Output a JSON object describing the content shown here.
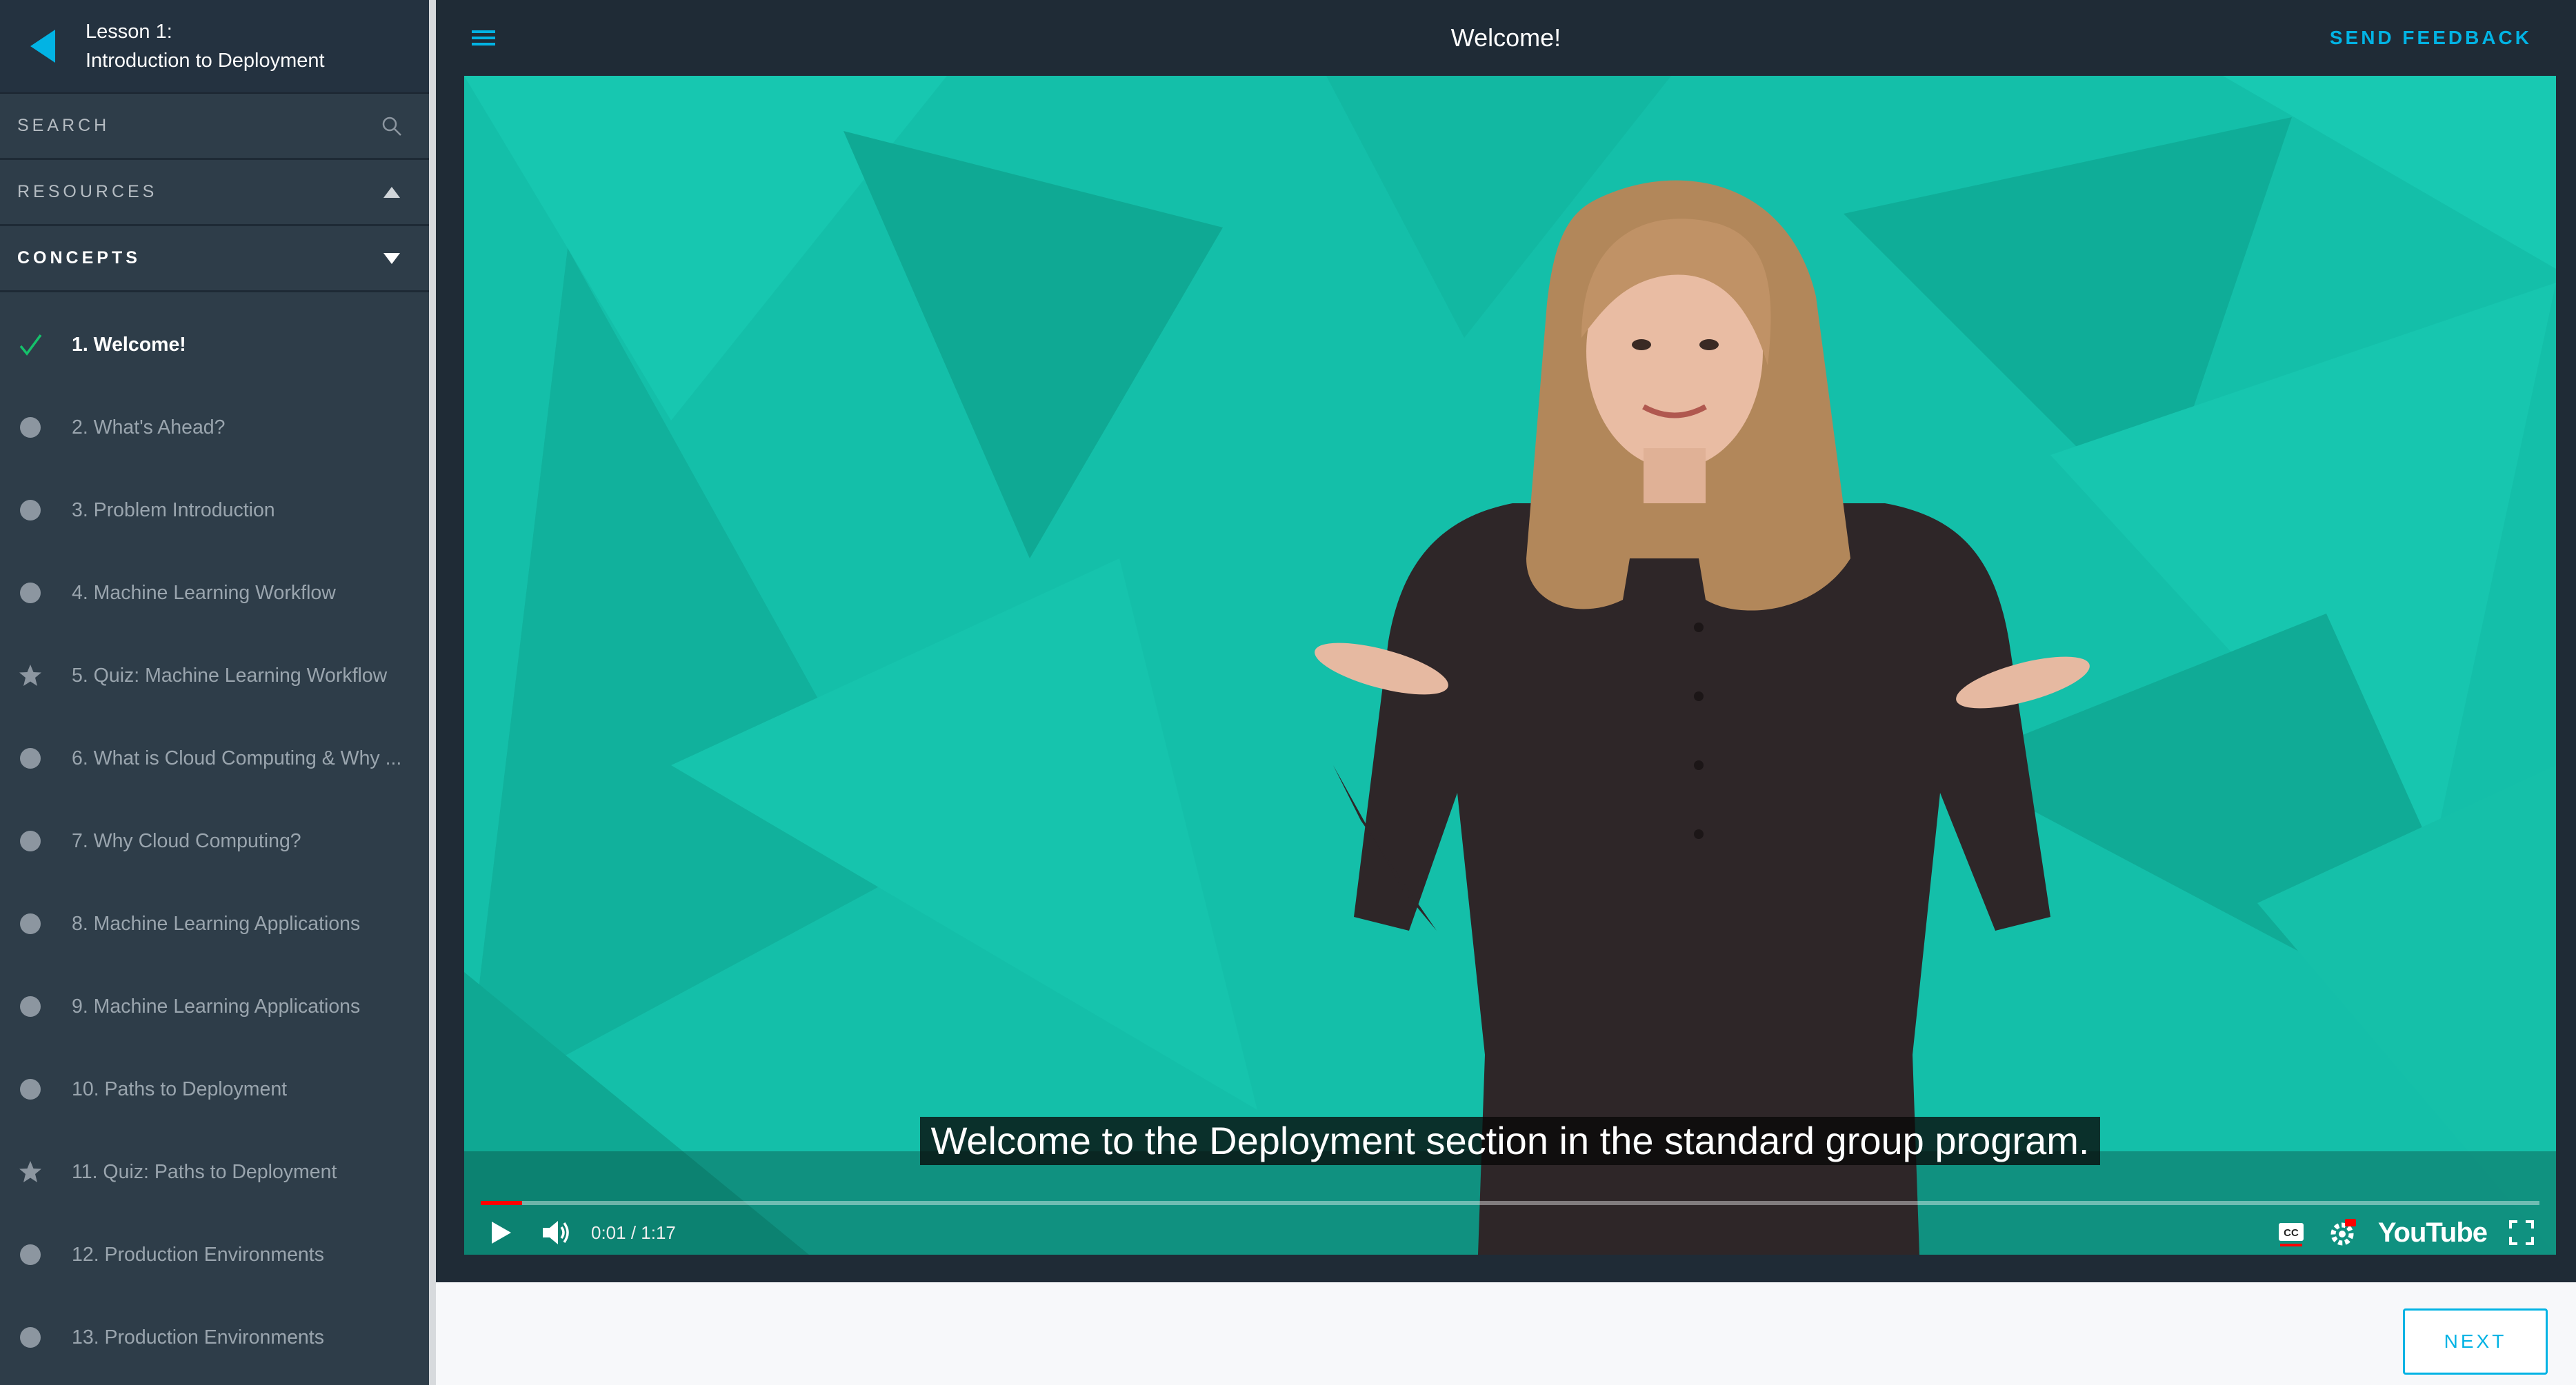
{
  "lesson": {
    "line1": "Lesson 1:",
    "line2": "Introduction to Deployment"
  },
  "sidebar": {
    "search_label": "SEARCH",
    "resources_label": "RESOURCES",
    "concepts_label": "CONCEPTS",
    "concepts": [
      {
        "label": "1. Welcome!",
        "icon": "check-icon",
        "active": true
      },
      {
        "label": "2. What's Ahead?",
        "icon": "dot-icon"
      },
      {
        "label": "3. Problem Introduction",
        "icon": "dot-icon"
      },
      {
        "label": "4. Machine Learning Workflow",
        "icon": "dot-icon"
      },
      {
        "label": "5. Quiz: Machine Learning Workflow",
        "icon": "star-icon"
      },
      {
        "label": "6. What is Cloud Computing & Why ...",
        "icon": "dot-icon"
      },
      {
        "label": "7. Why Cloud Computing?",
        "icon": "dot-icon"
      },
      {
        "label": "8. Machine Learning Applications",
        "icon": "dot-icon"
      },
      {
        "label": "9. Machine Learning Applications",
        "icon": "dot-icon"
      },
      {
        "label": "10. Paths to Deployment",
        "icon": "dot-icon"
      },
      {
        "label": "11. Quiz: Paths to Deployment",
        "icon": "star-icon"
      },
      {
        "label": "12. Production Environments",
        "icon": "dot-icon"
      },
      {
        "label": "13. Production Environments",
        "icon": "dot-icon"
      }
    ]
  },
  "header": {
    "title": "Welcome!",
    "feedback_label": "SEND FEEDBACK"
  },
  "video": {
    "caption": "Welcome to the Deployment section in the standard group program.",
    "time": "0:01 / 1:17",
    "progress_fraction": 0.02,
    "logo": "YouTube"
  },
  "footer": {
    "next_label": "NEXT"
  },
  "colors": {
    "accent": "#02b3e4",
    "sidebar_bg": "#2e3d49",
    "video_bg": "#14bfa9",
    "check": "#15c26b"
  }
}
